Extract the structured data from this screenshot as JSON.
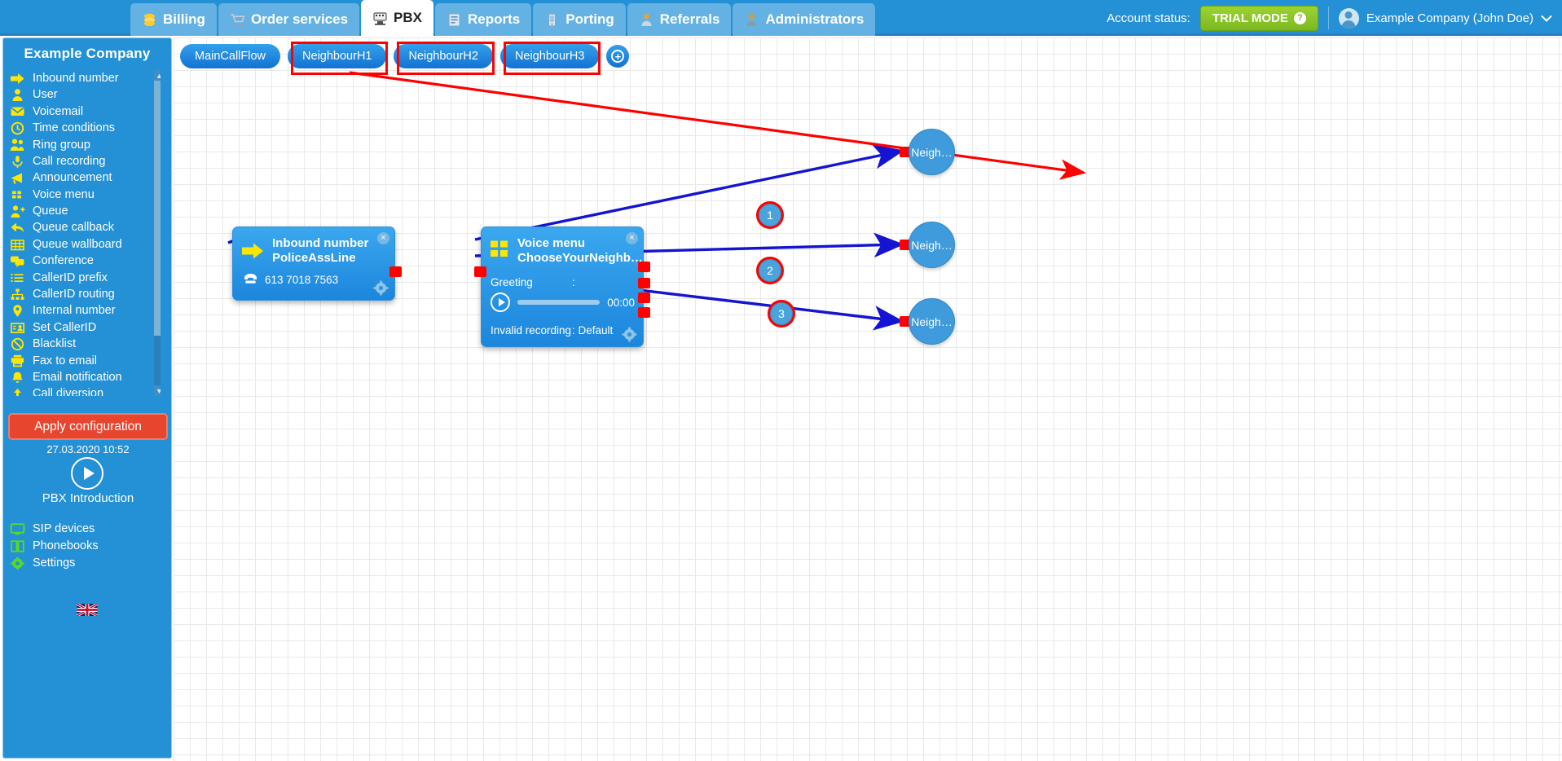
{
  "header": {
    "nav_tabs": [
      {
        "label": "Billing",
        "icon": "coins-icon",
        "active": false
      },
      {
        "label": "Order services",
        "icon": "cart-icon",
        "active": false
      },
      {
        "label": "PBX",
        "icon": "pbx-icon",
        "active": true
      },
      {
        "label": "Reports",
        "icon": "report-icon",
        "active": false
      },
      {
        "label": "Porting",
        "icon": "mobile-icon",
        "active": false
      },
      {
        "label": "Referrals",
        "icon": "person-award-icon",
        "active": false
      },
      {
        "label": "Administrators",
        "icon": "admin-person-icon",
        "active": false
      }
    ],
    "account_status_label": "Account status:",
    "trial_badge": "TRIAL MODE",
    "trial_help": "?",
    "user_name": "Example Company (John Doe)",
    "caret": "⌄"
  },
  "sidebar": {
    "title": "Example Company",
    "items": [
      {
        "label": "Inbound number",
        "icon": "arrow-right-icon"
      },
      {
        "label": "User",
        "icon": "person-icon"
      },
      {
        "label": "Voicemail",
        "icon": "envelope-icon"
      },
      {
        "label": "Time conditions",
        "icon": "clock-icon"
      },
      {
        "label": "Ring group",
        "icon": "group-icon"
      },
      {
        "label": "Call recording",
        "icon": "microphone-icon"
      },
      {
        "label": "Announcement",
        "icon": "megaphone-icon"
      },
      {
        "label": "Voice menu",
        "icon": "grid-squares-icon"
      },
      {
        "label": "Queue",
        "icon": "person-plus-icon"
      },
      {
        "label": "Queue callback",
        "icon": "arrow-return-icon"
      },
      {
        "label": "Queue wallboard",
        "icon": "table-icon"
      },
      {
        "label": "Conference",
        "icon": "chat-bubbles-icon"
      },
      {
        "label": "CallerID prefix",
        "icon": "list-icon"
      },
      {
        "label": "CallerID routing",
        "icon": "sitemap-icon"
      },
      {
        "label": "Internal number",
        "icon": "map-pin-icon"
      },
      {
        "label": "Set CallerID",
        "icon": "id-card-icon"
      },
      {
        "label": "Blacklist",
        "icon": "ban-icon"
      },
      {
        "label": "Fax to email",
        "icon": "printer-icon"
      },
      {
        "label": "Email notification",
        "icon": "bell-icon"
      },
      {
        "label": "Call diversion",
        "icon": "upload-icon"
      }
    ],
    "apply_button": "Apply configuration",
    "apply_timestamp": "27.03.2020 10:52",
    "intro_label": "PBX Introduction",
    "footer_items": [
      {
        "label": "SIP devices",
        "icon": "monitor-icon"
      },
      {
        "label": "Phonebooks",
        "icon": "book-icon"
      },
      {
        "label": "Settings",
        "icon": "gear-icon"
      }
    ],
    "language_flag": "uk-flag-icon",
    "scroll_up": "▲",
    "scroll_down": "▼"
  },
  "canvas": {
    "flow_tabs": [
      {
        "label": "MainCallFlow",
        "highlighted": false
      },
      {
        "label": "NeighbourH1",
        "highlighted": true
      },
      {
        "label": "NeighbourH2",
        "highlighted": true
      },
      {
        "label": "NeighbourH3",
        "highlighted": true
      }
    ],
    "add_tab_label": "+",
    "nodes": {
      "inbound": {
        "type": "Inbound number",
        "name": "PoliceAssLine",
        "phone_icon": "telephone-icon",
        "phone": "613 7018 7563",
        "close": "×",
        "gear": "gear-icon"
      },
      "voicemenu": {
        "type": "Voice menu",
        "name": "ChooseYourNeighb…",
        "greeting_label": "Greeting",
        "greeting_sep": ":",
        "greeting_value": "",
        "play_icon": "play-icon",
        "duration": "00:00",
        "invalid_label": "Invalid recording",
        "invalid_value": ": Default",
        "close": "×",
        "gear": "gear-icon"
      }
    },
    "end_nodes": [
      {
        "label": "Neigh…"
      },
      {
        "label": "Neigh…"
      },
      {
        "label": "Neigh…"
      }
    ],
    "branch_badges": [
      "1",
      "2",
      "3"
    ],
    "annotation": {
      "arrow_color": "#ff0000",
      "highlight_color": "#ff0000"
    }
  },
  "colors": {
    "brand_blue": "#2490d6",
    "nav_tab": "#64b2e4",
    "node_blue": "#2f95e0",
    "apply_red": "#e8452f",
    "trial_green": "#8cc828",
    "port_red": "#ff0000",
    "connector_blue": "#1414d2",
    "sidebar_icon_yellow": "#ffe600",
    "sidebar_icon_green": "#57d926"
  }
}
